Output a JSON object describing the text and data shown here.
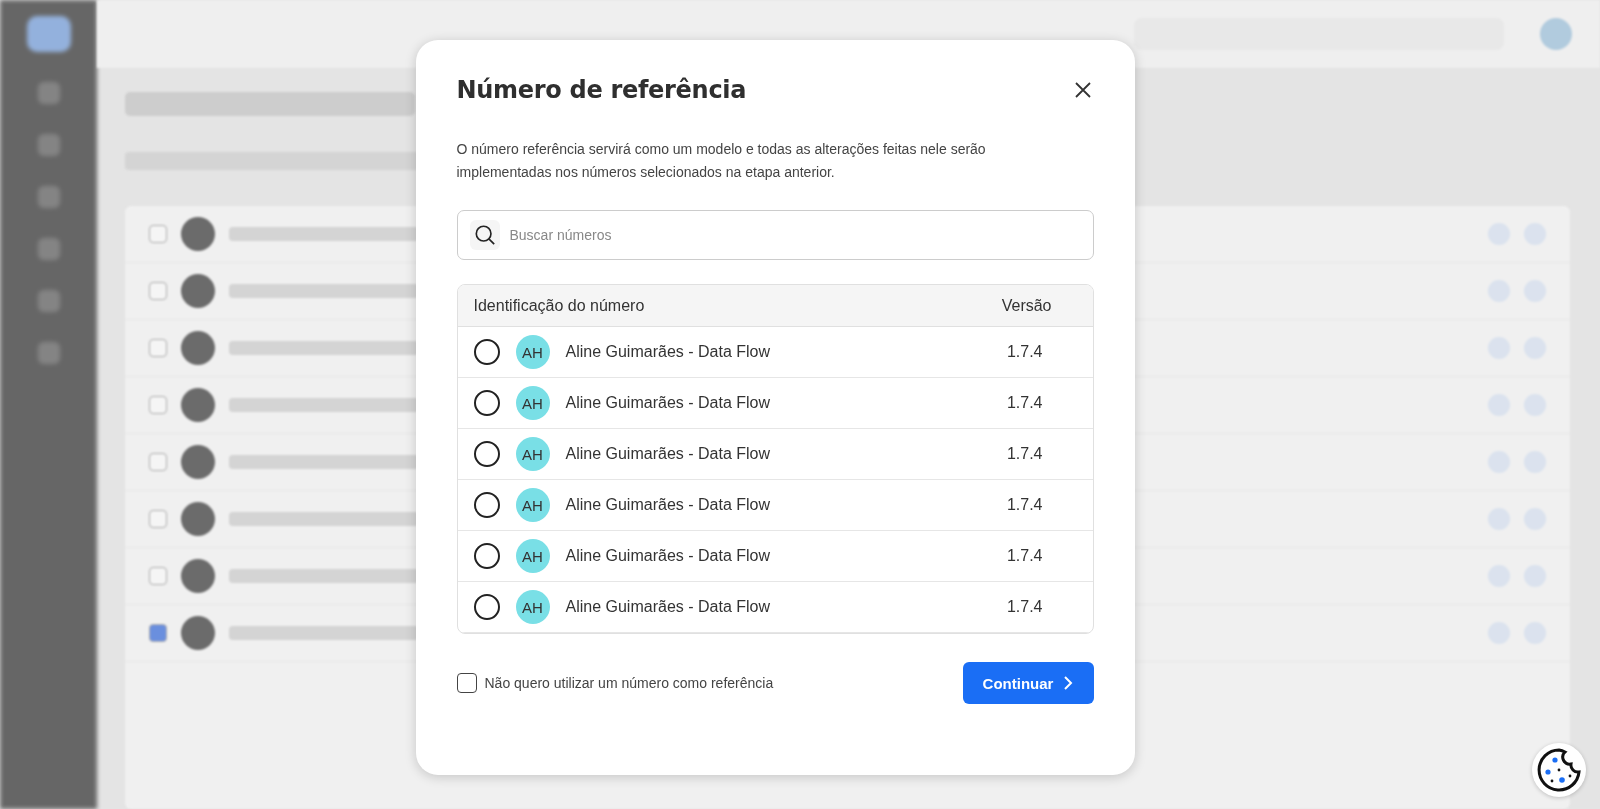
{
  "background": {
    "rows": [
      {
        "checked": false
      },
      {
        "checked": false
      },
      {
        "checked": false
      },
      {
        "checked": false
      },
      {
        "checked": false
      },
      {
        "checked": false
      },
      {
        "checked": false
      },
      {
        "checked": true
      }
    ]
  },
  "dialog": {
    "title": "Número de referência",
    "description": "O número referência servirá como um modelo e todas as alterações feitas nele serão implementadas nos números selecionados na etapa anterior.",
    "search": {
      "placeholder": "Buscar números"
    },
    "table": {
      "columns": [
        "Identificação do número",
        "Versão"
      ],
      "rows": [
        {
          "initials": "AH",
          "name": "Aline Guimarães - Data Flow",
          "version": "1.7.4",
          "selected": false
        },
        {
          "initials": "AH",
          "name": "Aline Guimarães - Data Flow",
          "version": "1.7.4",
          "selected": false
        },
        {
          "initials": "AH",
          "name": "Aline Guimarães - Data Flow",
          "version": "1.7.4",
          "selected": false
        },
        {
          "initials": "AH",
          "name": "Aline Guimarães - Data Flow",
          "version": "1.7.4",
          "selected": false
        },
        {
          "initials": "AH",
          "name": "Aline Guimarães - Data Flow",
          "version": "1.7.4",
          "selected": false
        },
        {
          "initials": "AH",
          "name": "Aline Guimarães - Data Flow",
          "version": "1.7.4",
          "selected": false
        }
      ]
    },
    "opt_out": {
      "label": "Não quero utilizar um número como referência",
      "checked": false
    },
    "continue_button": "Continuar"
  }
}
